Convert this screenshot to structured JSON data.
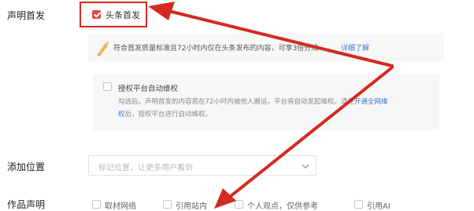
{
  "declare": {
    "label": "声明首发",
    "option_label": "头条首发",
    "notice_text": "符合首发质量标准且72小时内仅在头条发布的内容，可享3倍分成",
    "notice_link": "详细了解"
  },
  "rights": {
    "label": "授权平台自动维权",
    "desc_line1": "勾选后，声明首发的内容若在72小时内被他人搬运，平台将自动发起维权。请在",
    "desc_link1": "开通全网维",
    "desc_link2": "权",
    "desc_line2": "后，授权平台进行自动维权。"
  },
  "location": {
    "label": "添加位置",
    "placeholder": "标记位置，让更多用户看到"
  },
  "author_declare": {
    "label": "作品声明",
    "options": [
      "取材网络",
      "引用站内",
      "个人观点，仅供参考",
      "引用AI"
    ]
  },
  "colors": {
    "accent": "#e8454a",
    "highlight": "#d42a20",
    "link": "#3c77d6"
  }
}
